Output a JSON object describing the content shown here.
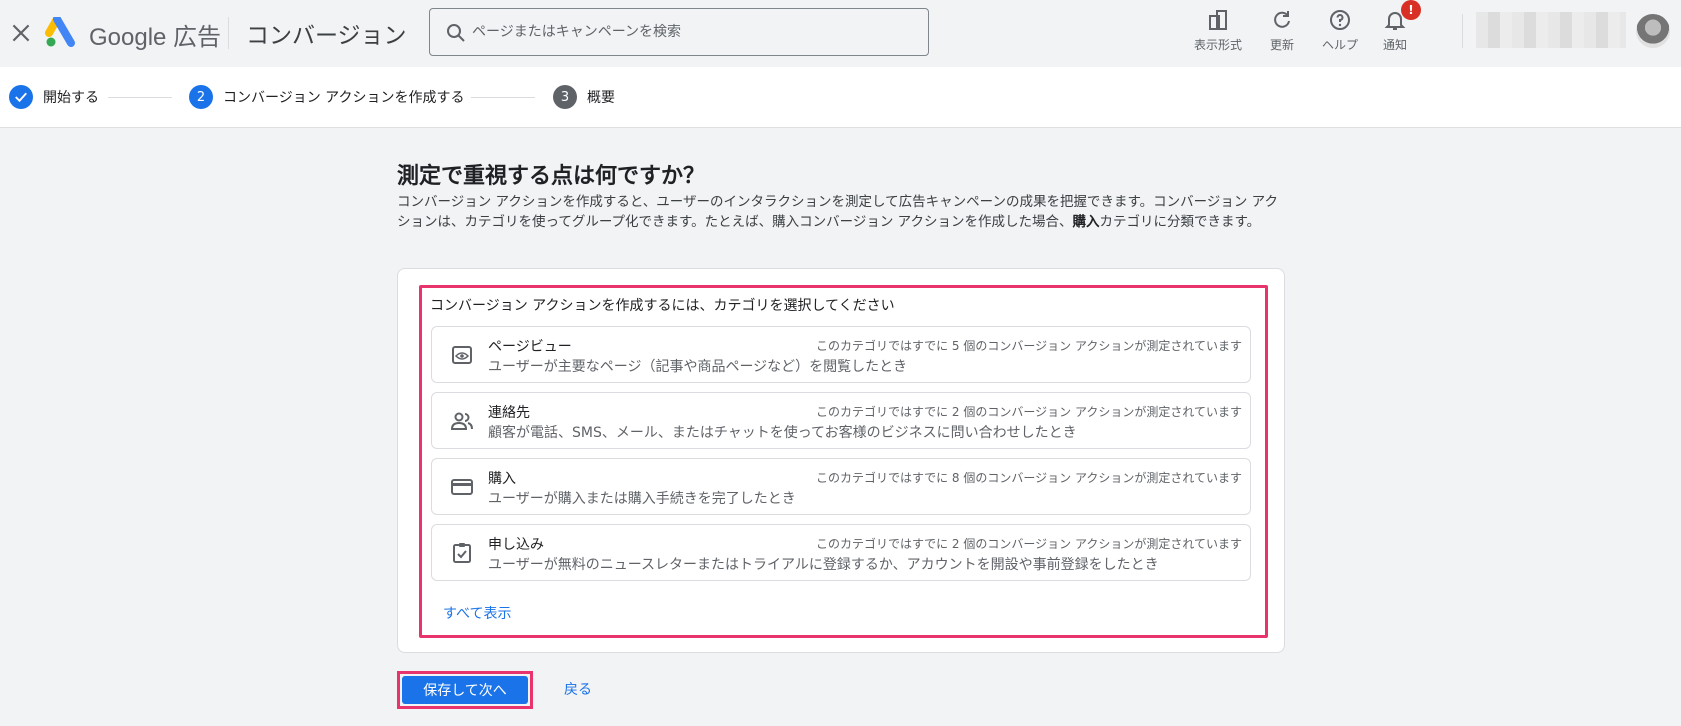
{
  "header": {
    "brand": "Google 広告",
    "title": "コンバージョン",
    "search_placeholder": "ページまたはキャンペーンを検索",
    "tools": [
      {
        "label": "表示形式",
        "icon": "appearance-icon"
      },
      {
        "label": "更新",
        "icon": "refresh-icon"
      },
      {
        "label": "ヘルプ",
        "icon": "help-icon"
      },
      {
        "label": "通知",
        "icon": "bell-icon"
      }
    ],
    "notification_badge": "!"
  },
  "stepper": {
    "steps": [
      {
        "number": "",
        "label": "開始する",
        "state": "done"
      },
      {
        "number": "2",
        "label": "コンバージョン アクションを作成する",
        "state": "active"
      },
      {
        "number": "3",
        "label": "概要",
        "state": "pending"
      }
    ]
  },
  "main": {
    "question": "測定で重視する点は何ですか？",
    "description_part1": "コンバージョン アクションを作成すると、ユーザーのインタラクションを測定して広告キャンペーンの成果を把握できます。コンバージョン アクションは、カテゴリを使ってグループ化できます。たとえば、購入コンバージョン アクションを作成した場合、",
    "description_bold": "購入",
    "description_part2": "カテゴリに分類できます。",
    "card_heading": "コンバージョン アクションを作成するには、カテゴリを選択してください",
    "options": [
      {
        "name": "ページビュー",
        "desc": "ユーザーが主要なページ（記事や商品ページなど）を閲覧したとき",
        "count": "このカテゴリではすでに 5 個のコンバージョン アクションが測定されています",
        "icon": "pageview-icon"
      },
      {
        "name": "連絡先",
        "desc": "顧客が電話、SMS、メール、またはチャットを使ってお客様のビジネスに問い合わせしたとき",
        "count": "このカテゴリではすでに 2 個のコンバージョン アクションが測定されています",
        "icon": "contacts-icon"
      },
      {
        "name": "購入",
        "desc": "ユーザーが購入または購入手続きを完了したとき",
        "count": "このカテゴリではすでに 8 個のコンバージョン アクションが測定されています",
        "icon": "credit-card-icon"
      },
      {
        "name": "申し込み",
        "desc": "ユーザーが無料のニュースレターまたはトライアルに登録するか、アカウントを開設や事前登録をしたとき",
        "count": "このカテゴリではすでに 2 個のコンバージョン アクションが測定されています",
        "icon": "clipboard-check-icon"
      }
    ],
    "show_all": "すべて表示",
    "save_next": "保存して次へ",
    "back": "戻る"
  },
  "colors": {
    "accent": "#1a73e8",
    "highlight": "#e8336d",
    "badge": "#d93025"
  }
}
